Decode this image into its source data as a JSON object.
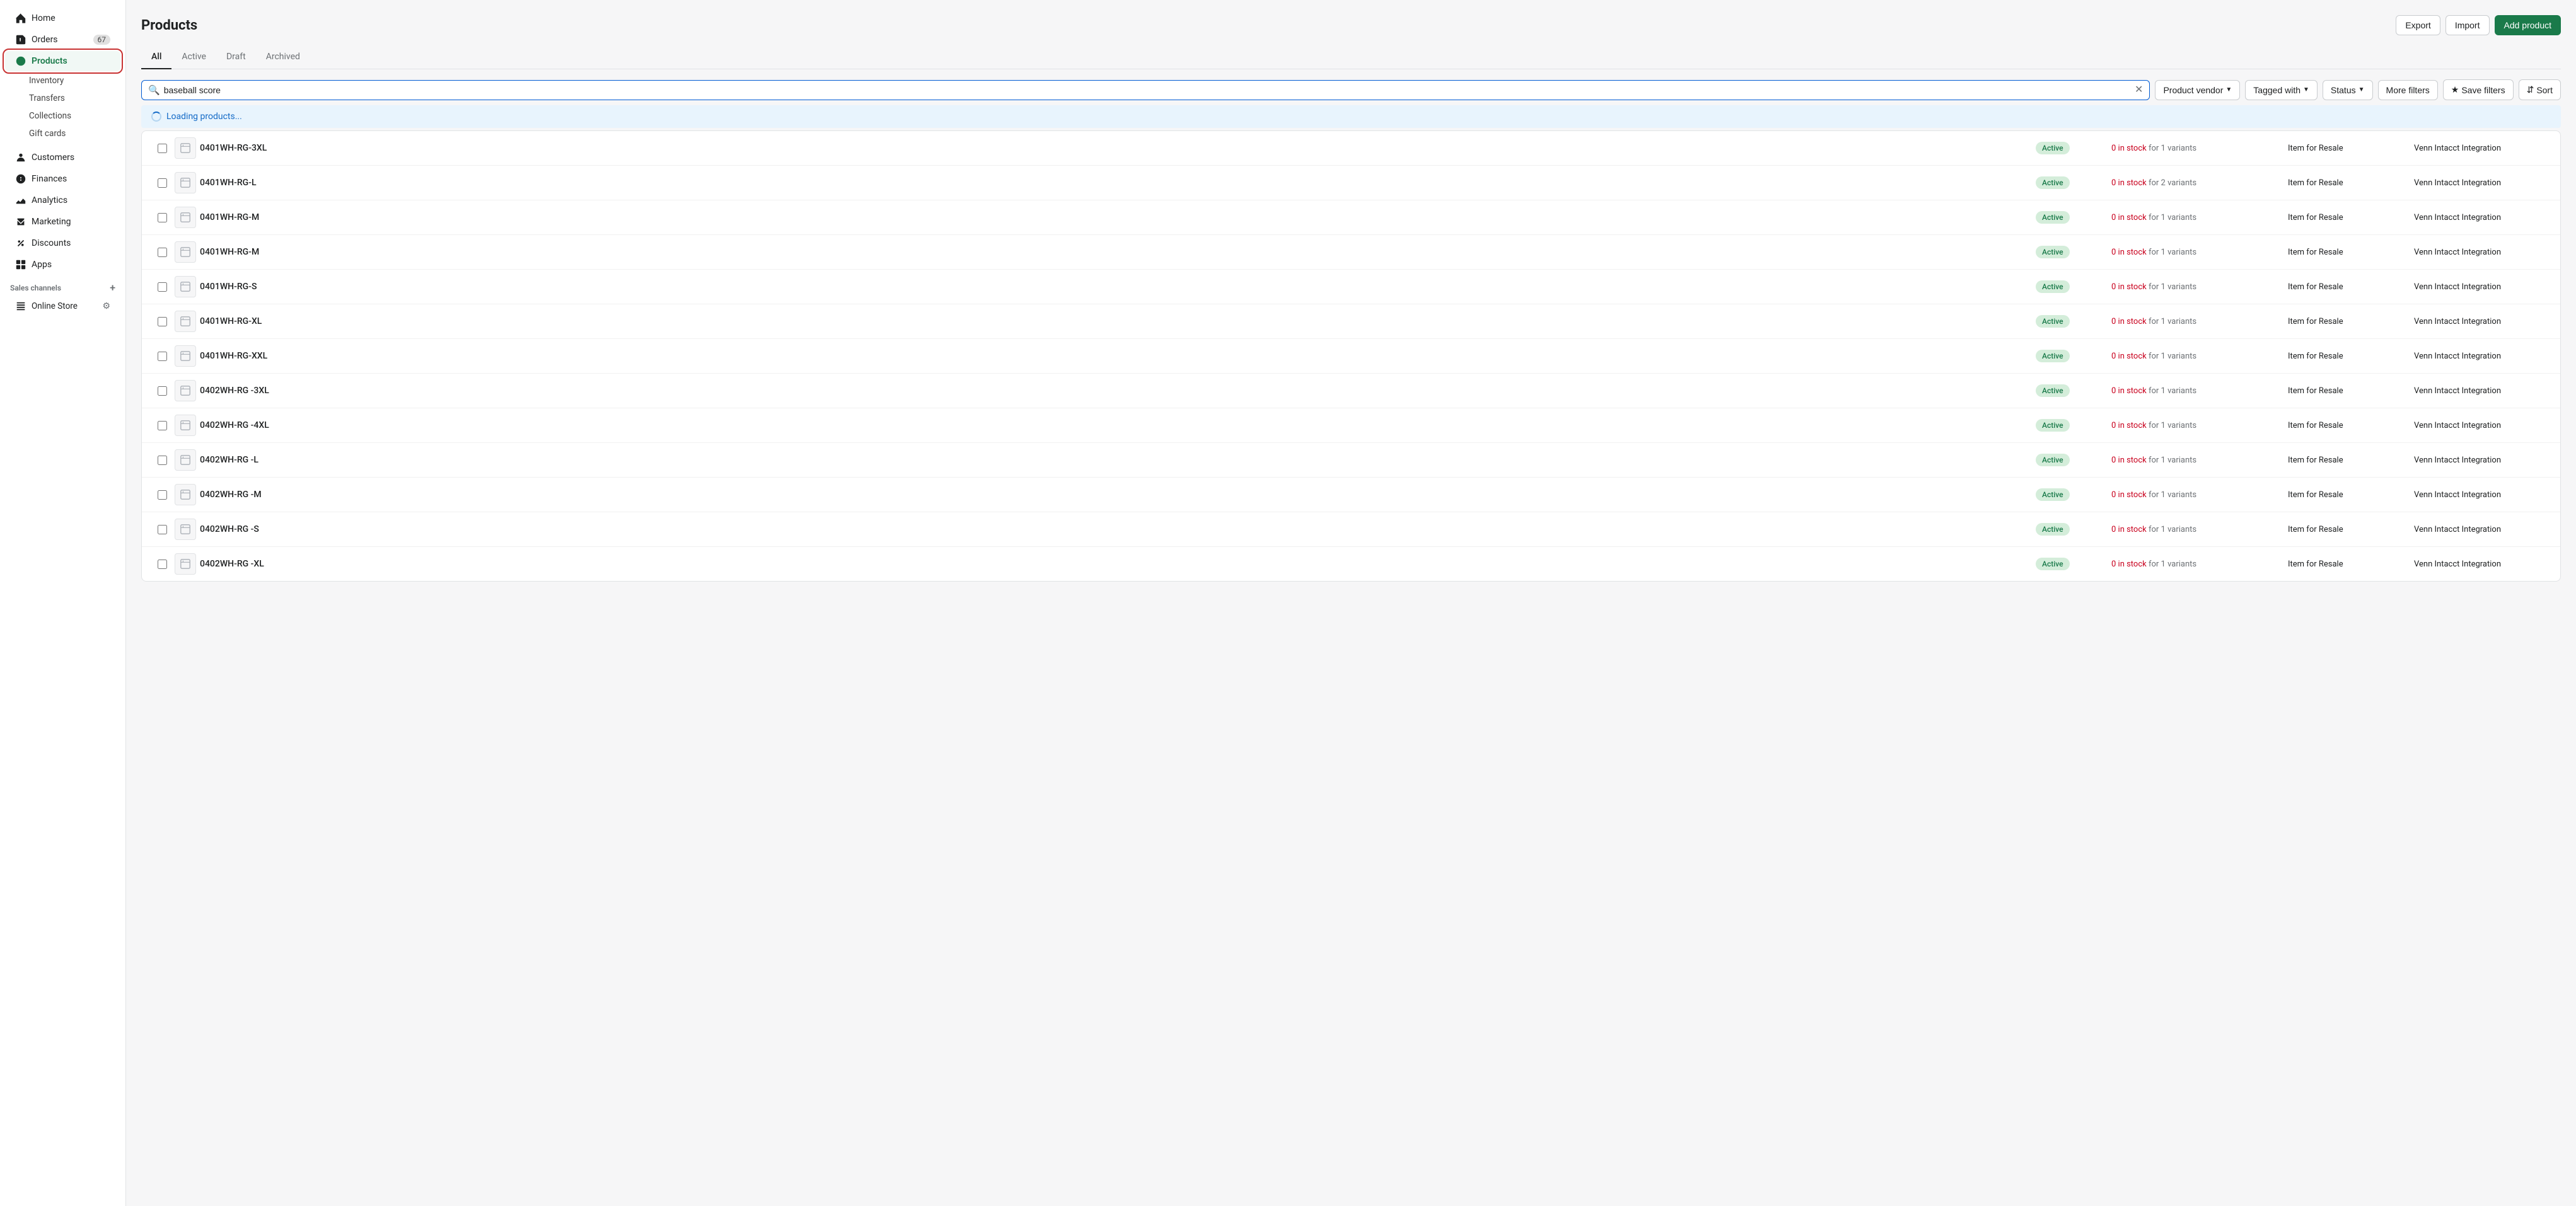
{
  "sidebar": {
    "items": [
      {
        "id": "home",
        "label": "Home",
        "icon": "home"
      },
      {
        "id": "orders",
        "label": "Orders",
        "icon": "orders",
        "badge": "67"
      },
      {
        "id": "products",
        "label": "Products",
        "icon": "products",
        "active": true
      },
      {
        "id": "customers",
        "label": "Customers",
        "icon": "customers"
      },
      {
        "id": "finances",
        "label": "Finances",
        "icon": "finances"
      },
      {
        "id": "analytics",
        "label": "Analytics",
        "icon": "analytics"
      },
      {
        "id": "marketing",
        "label": "Marketing",
        "icon": "marketing"
      },
      {
        "id": "discounts",
        "label": "Discounts",
        "icon": "discounts"
      },
      {
        "id": "apps",
        "label": "Apps",
        "icon": "apps"
      }
    ],
    "sub_items": [
      {
        "id": "inventory",
        "label": "Inventory"
      },
      {
        "id": "transfers",
        "label": "Transfers"
      },
      {
        "id": "collections",
        "label": "Collections"
      },
      {
        "id": "gift-cards",
        "label": "Gift cards"
      }
    ],
    "sales_channels_label": "Sales channels",
    "channels": [
      {
        "id": "online-store",
        "label": "Online Store"
      }
    ]
  },
  "page": {
    "title": "Products",
    "export_label": "Export",
    "import_label": "Import",
    "add_product_label": "Add product"
  },
  "tabs": [
    {
      "id": "all",
      "label": "All",
      "active": true
    },
    {
      "id": "active",
      "label": "Active"
    },
    {
      "id": "draft",
      "label": "Draft"
    },
    {
      "id": "archived",
      "label": "Archived"
    }
  ],
  "filters": {
    "search_placeholder": "baseball score",
    "search_value": "baseball score",
    "product_vendor_label": "Product vendor",
    "tagged_with_label": "Tagged with",
    "status_label": "Status",
    "more_filters_label": "More filters",
    "save_filters_label": "Save filters",
    "sort_label": "Sort"
  },
  "loading": {
    "text": "Loading products..."
  },
  "products": [
    {
      "id": 1,
      "name": "0401WH-RG-3XL",
      "status": "Active",
      "stock": "0 in stock",
      "variants": "for 1 variants",
      "category": "Item for Resale",
      "vendor": "Venn Intacct Integration"
    },
    {
      "id": 2,
      "name": "0401WH-RG-L",
      "status": "Active",
      "stock": "0 in stock",
      "variants": "for 2 variants",
      "category": "Item for Resale",
      "vendor": "Venn Intacct Integration"
    },
    {
      "id": 3,
      "name": "0401WH-RG-M",
      "status": "Active",
      "stock": "0 in stock",
      "variants": "for 1 variants",
      "category": "Item for Resale",
      "vendor": "Venn Intacct Integration"
    },
    {
      "id": 4,
      "name": "0401WH-RG-M",
      "status": "Active",
      "stock": "0 in stock",
      "variants": "for 1 variants",
      "category": "Item for Resale",
      "vendor": "Venn Intacct Integration"
    },
    {
      "id": 5,
      "name": "0401WH-RG-S",
      "status": "Active",
      "stock": "0 in stock",
      "variants": "for 1 variants",
      "category": "Item for Resale",
      "vendor": "Venn Intacct Integration"
    },
    {
      "id": 6,
      "name": "0401WH-RG-XL",
      "status": "Active",
      "stock": "0 in stock",
      "variants": "for 1 variants",
      "category": "Item for Resale",
      "vendor": "Venn Intacct Integration"
    },
    {
      "id": 7,
      "name": "0401WH-RG-XXL",
      "status": "Active",
      "stock": "0 in stock",
      "variants": "for 1 variants",
      "category": "Item for Resale",
      "vendor": "Venn Intacct Integration"
    },
    {
      "id": 8,
      "name": "0402WH-RG -3XL",
      "status": "Active",
      "stock": "0 in stock",
      "variants": "for 1 variants",
      "category": "Item for Resale",
      "vendor": "Venn Intacct Integration"
    },
    {
      "id": 9,
      "name": "0402WH-RG -4XL",
      "status": "Active",
      "stock": "0 in stock",
      "variants": "for 1 variants",
      "category": "Item for Resale",
      "vendor": "Venn Intacct Integration"
    },
    {
      "id": 10,
      "name": "0402WH-RG -L",
      "status": "Active",
      "stock": "0 in stock",
      "variants": "for 1 variants",
      "category": "Item for Resale",
      "vendor": "Venn Intacct Integration"
    },
    {
      "id": 11,
      "name": "0402WH-RG -M",
      "status": "Active",
      "stock": "0 in stock",
      "variants": "for 1 variants",
      "category": "Item for Resale",
      "vendor": "Venn Intacct Integration"
    },
    {
      "id": 12,
      "name": "0402WH-RG -S",
      "status": "Active",
      "stock": "0 in stock",
      "variants": "for 1 variants",
      "category": "Item for Resale",
      "vendor": "Venn Intacct Integration"
    },
    {
      "id": 13,
      "name": "0402WH-RG -XL",
      "status": "Active",
      "stock": "0 in stock",
      "variants": "for 1 variants",
      "category": "Item for Resale",
      "vendor": "Venn Intacct Integration"
    }
  ]
}
